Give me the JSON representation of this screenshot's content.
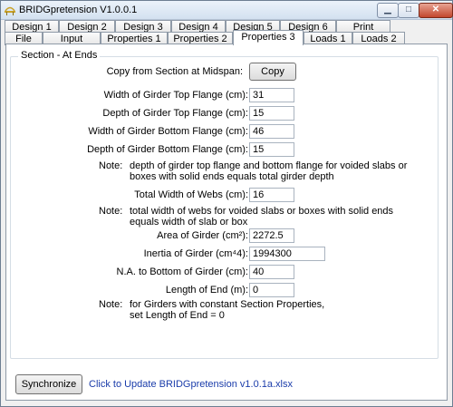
{
  "window": {
    "title": "BRIDGpretension V1.0.0.1"
  },
  "tabs_row1": [
    "Design 1",
    "Design 2",
    "Design 3",
    "Design 4",
    "Design 5",
    "Design 6",
    "Print"
  ],
  "tabs_row2": [
    "File",
    "Input",
    "Properties 1",
    "Properties 2",
    "Properties 3",
    "Loads 1",
    "Loads 2"
  ],
  "active_tab": "Properties 3",
  "section": {
    "title": "Section - At Ends",
    "copy_label": "Copy from Section at Midspan:",
    "copy_button": "Copy",
    "fields": {
      "top_flange_width": {
        "label": "Width of Girder Top Flange (cm):",
        "value": "31"
      },
      "top_flange_depth": {
        "label": "Depth of Girder Top Flange (cm):",
        "value": "15"
      },
      "bottom_flange_width": {
        "label": "Width of Girder Bottom Flange (cm):",
        "value": "46"
      },
      "bottom_flange_depth": {
        "label": "Depth of Girder Bottom Flange (cm):",
        "value": "15"
      },
      "webs_width": {
        "label": "Total Width of Webs (cm):",
        "value": "16"
      },
      "area": {
        "label": "Area of Girder (cm²):",
        "value": "2272.5"
      },
      "inertia": {
        "label": "Inertia of Girder (cm⁴4):",
        "value": "1994300"
      },
      "na_bottom": {
        "label": "N.A. to Bottom of Girder (cm):",
        "value": "40"
      },
      "length_end": {
        "label": "Length of End (m):",
        "value": "0"
      }
    },
    "note_label": "Note:",
    "note1_line1": "depth of girder top flange and bottom flange for voided slabs or",
    "note1_line2": "boxes with solid ends equals total girder depth",
    "note2_line1": "total width of webs for voided slabs or boxes with solid ends",
    "note2_line2": "equals width of slab or box",
    "note3_line1": "for Girders with constant Section Properties,",
    "note3_line2": "set Length of End = 0"
  },
  "footer": {
    "sync_button": "Synchronize",
    "update_link": "Click to Update BRIDGpretension v1.0.1a.xlsx"
  }
}
